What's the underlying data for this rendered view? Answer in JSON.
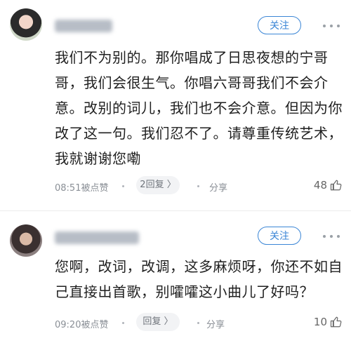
{
  "comments": [
    {
      "follow_label": "关注",
      "text": "我们不为别的。那你唱成了日思夜想的宁哥哥，我们会很生气。你唱六哥哥我们不会介意。改别的词儿，我们也不会介意。但因为你改了这一句。我们忍不了。请尊重传统艺术，我就谢谢您嘞",
      "time": "08:51被点赞",
      "reply_label": "2回复 〉",
      "share_label": "分享",
      "likes": "48"
    },
    {
      "follow_label": "关注",
      "text": "您啊，改词，改调，这多麻烦呀，你还不如自己直接出首歌，别嚯嚯这小曲儿了好吗？",
      "time": "09:20被点赞",
      "reply_label": "回复 〉",
      "share_label": "分享",
      "likes": "10"
    }
  ]
}
